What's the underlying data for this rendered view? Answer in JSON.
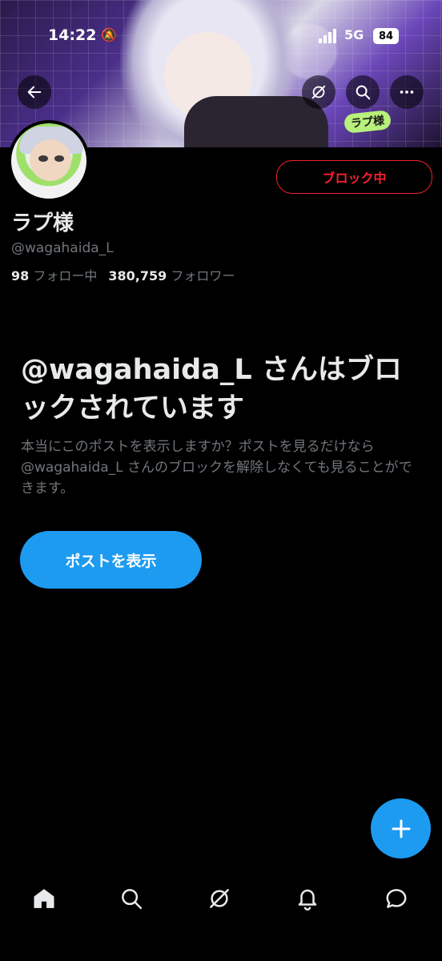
{
  "status_bar": {
    "time": "14:22",
    "network": "5G",
    "battery": "84"
  },
  "banner": {
    "tag_text": "ラプ様"
  },
  "header": {
    "back_icon": "arrow-left-icon",
    "grok_icon": "grok-icon",
    "search_icon": "search-icon",
    "more_icon": "more-icon"
  },
  "profile": {
    "display_name": "ラプ様",
    "handle": "@wagahaida_L",
    "following_count": "98",
    "following_label": "フォロー中",
    "followers_count": "380,759",
    "followers_label": "フォロワー",
    "blocking_label": "ブロック中"
  },
  "blocked_notice": {
    "title": "@wagahaida_L さんはブロックされています",
    "description": "本当にこのポストを表示しますか？ポストを見るだけなら @wagahaida_L さんのブロックを解除しなくても見ることができます。",
    "button_label": "ポストを表示"
  },
  "bottom_nav": [
    "home-icon",
    "search-icon",
    "grok-icon",
    "notifications-icon",
    "messages-icon"
  ],
  "colors": {
    "accent": "#1d9bf0",
    "danger": "#f4212e",
    "background": "#000000",
    "text_primary": "#e7e9ea",
    "text_secondary": "#71767b"
  }
}
